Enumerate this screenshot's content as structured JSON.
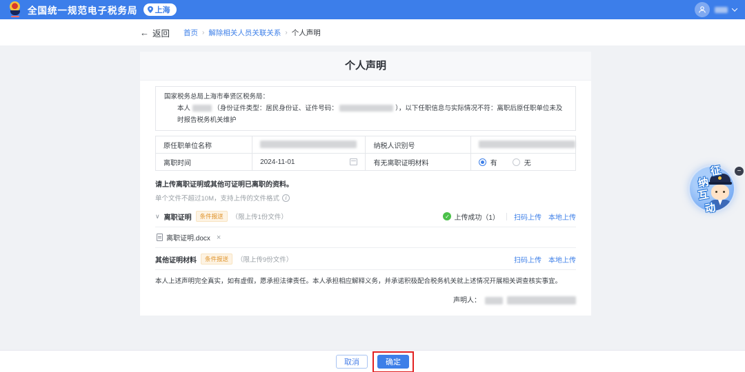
{
  "colors": {
    "header_bg": "#3c7eea",
    "primary_blue": "#3d7fe8",
    "badge_orange": "#e0952e",
    "success_green": "#4cc14a",
    "annotation_red": "#e22020",
    "page_bg": "#f0f2f5"
  },
  "icons": {
    "back_arrow": "←",
    "breadcrumb_separator": "›",
    "collapse_chevron": "∨",
    "check": "✓",
    "close": "×",
    "info": "i",
    "minus": "−"
  },
  "header": {
    "app_title": "全国统一规范电子税务局",
    "location": "上海"
  },
  "breadcrumb": {
    "back_label": "返回",
    "items": [
      "首页",
      "解除相关人员关联关系",
      "个人声明"
    ]
  },
  "card": {
    "title": "个人声明",
    "declaration": {
      "salutation": "国家税务总局上海市奉贤区税务局：",
      "body_prefix": "本人",
      "body_mid": "（身份证件类型：居民身份证、证件号码：",
      "body_suffix": "），以下任职信息与实际情况不符：离职后原任职单位未及时报告税务机关维护"
    },
    "info_table": {
      "row1": {
        "label1": "原任职单位名称",
        "label2": "纳税人识别号"
      },
      "row2": {
        "label1": "离职时间",
        "value1": "2024-11-01",
        "label2": "有无离职证明材料",
        "radio_yes": "有",
        "radio_no": "无"
      }
    },
    "upload": {
      "instruction": "请上传离职证明或其他可证明已离职的资料。",
      "hint": "单个文件不超过10M，支持上传的文件格式",
      "sections": [
        {
          "name": "离职证明",
          "badge": "条件报送",
          "limit": "（限上传1份文件）",
          "status": "上传成功（1）",
          "scan_upload": "扫码上传",
          "local_upload": "本地上传",
          "file_name": "离职证明.docx"
        },
        {
          "name": "其他证明材料",
          "badge": "条件报送",
          "limit": "（限上传9份文件）",
          "scan_upload": "扫码上传",
          "local_upload": "本地上传"
        }
      ]
    },
    "statement": "本人上述声明完全真实，如有虚假，愿承担法律责任。本人承担相应解释义务，并承诺积极配合税务机关就上述情况开展相关调查核实事宜。",
    "signer_label": "声明人："
  },
  "footer": {
    "cancel": "取消",
    "confirm": "确定"
  },
  "float_widget": {
    "chars": [
      "征",
      "纳",
      "互",
      "动"
    ]
  }
}
